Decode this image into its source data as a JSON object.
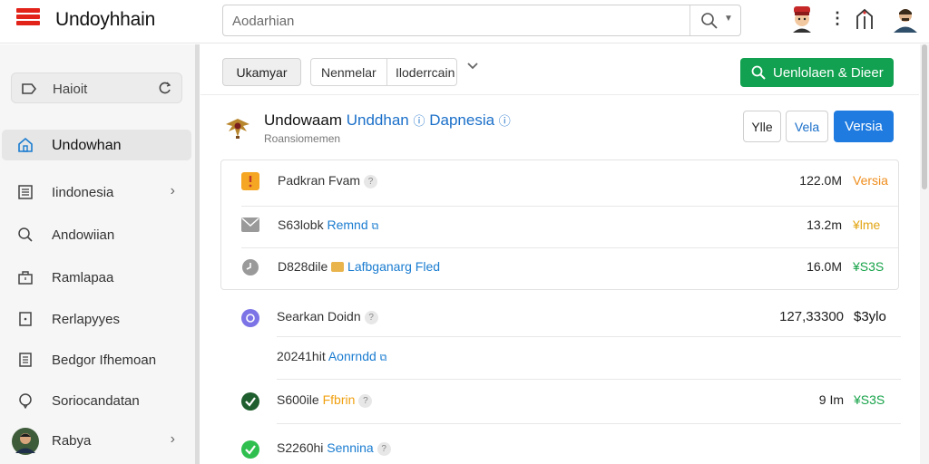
{
  "app": {
    "title": "Undoyhhain"
  },
  "search": {
    "placeholder": "Aodarhian"
  },
  "sidebar": {
    "top": {
      "label": "Haioit"
    },
    "items": [
      {
        "label": "Undowhan",
        "active": true,
        "icon": "home-icon"
      },
      {
        "label": "Iindonesia",
        "icon": "list-icon",
        "chevron": true
      },
      {
        "label": "Andowiian",
        "icon": "search-icon"
      },
      {
        "label": "Ramlapaa",
        "icon": "bag-icon"
      },
      {
        "label": "Rerlapyyes",
        "icon": "file-icon"
      },
      {
        "label": "Bedgor Ifhemoan",
        "icon": "document-icon"
      },
      {
        "label": "Soriocandatan",
        "icon": "chat-icon"
      },
      {
        "label": "Rabya",
        "icon": "avatar",
        "chevron": true
      }
    ]
  },
  "toolbar": {
    "gray_button": "Ukamyar",
    "seg_left": "Nenmelar",
    "seg_right": "Iloderrcain",
    "green_button": "Uenlolaen & Dieer"
  },
  "entity": {
    "title_main": "Undowaam",
    "title_blue": "Unddhan",
    "title_tail": "Dapnesia",
    "subtitle": "Roansiomemen",
    "btn_a": "Ylle",
    "btn_b": "Vela",
    "btn_primary": "Versia"
  },
  "card_rows": [
    {
      "name": "Padkran Fvam",
      "value": "122.0M",
      "tag": "Versia"
    },
    {
      "name": "S63lobk",
      "link": "Remnd",
      "value": "13.2m",
      "tag": "¥lme"
    },
    {
      "name": "D828dile",
      "link": "Lafbganarg Fled",
      "value": "16.0M",
      "tag": "¥S3S"
    }
  ],
  "list_rows": [
    {
      "name": "Searkan Doidn",
      "value": "127,33300",
      "tag": "$3ylo"
    },
    {
      "name": "20241hit",
      "link": "Aonrndd"
    },
    {
      "name": "S600ile",
      "link": "Ffbrin",
      "value": "9 Im",
      "tag": "¥S3S"
    },
    {
      "name": "S2260hi",
      "link": "Sennina"
    }
  ],
  "colors": {
    "accent_green": "#12a150",
    "accent_blue": "#1f7be0",
    "link_blue": "#1a7cd0",
    "tag_orange": "#ef8d1c",
    "tag_green": "#18a34a"
  }
}
